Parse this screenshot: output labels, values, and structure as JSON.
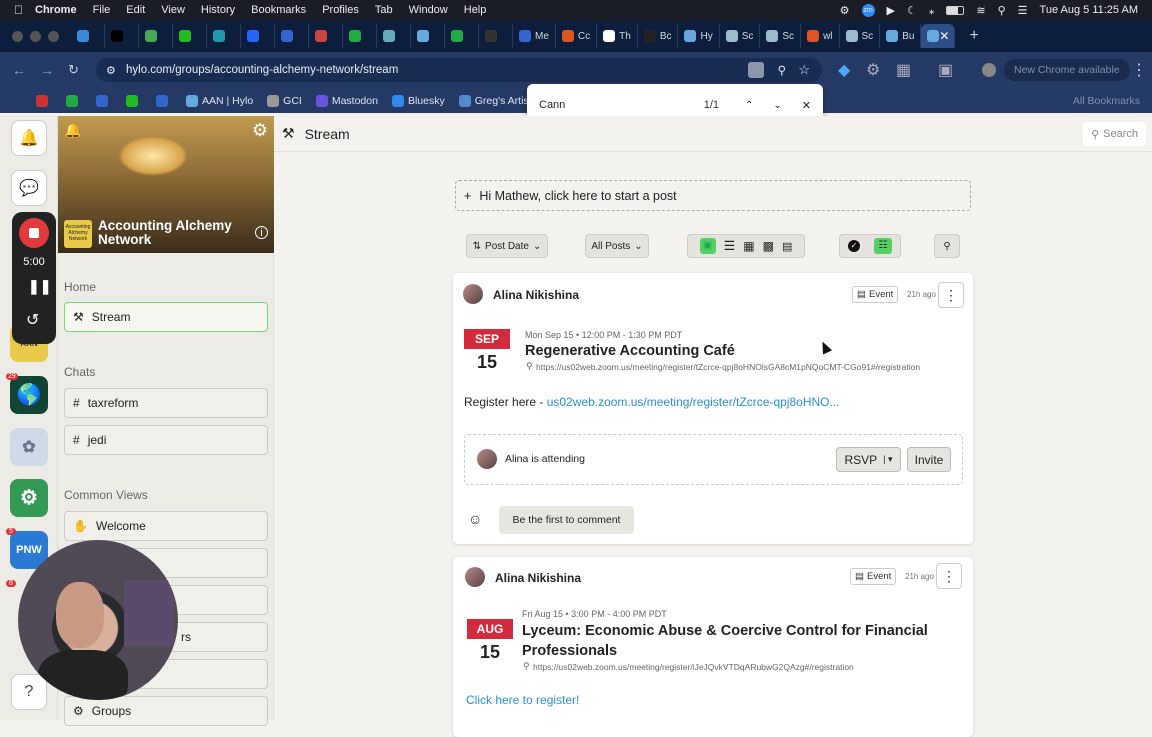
{
  "menubar": {
    "apple": "",
    "items": [
      "Chrome",
      "File",
      "Edit",
      "View",
      "History",
      "Bookmarks",
      "Profiles",
      "Tab",
      "Window",
      "Help"
    ],
    "clock": "Tue Aug 5  11:25 AM"
  },
  "tabs": [
    {
      "label": "",
      "c": "#3b8ad8"
    },
    {
      "label": "",
      "c": "#000"
    },
    {
      "label": "",
      "c": "#4a5"
    },
    {
      "label": "",
      "c": "#2b2"
    },
    {
      "label": "",
      "c": "#29a"
    },
    {
      "label": "",
      "c": "#2962ff"
    },
    {
      "label": "",
      "c": "#36c"
    },
    {
      "label": "",
      "c": "#c44"
    },
    {
      "label": "",
      "c": "#2a4"
    },
    {
      "label": "",
      "c": "#6ab"
    },
    {
      "label": "",
      "c": "#6ad"
    },
    {
      "label": "",
      "c": "#2a4"
    },
    {
      "label": "",
      "c": "#333"
    },
    {
      "label": "Me",
      "c": "#36c"
    },
    {
      "label": "Cc",
      "c": "#d52"
    },
    {
      "label": "Th",
      "c": "#fff"
    },
    {
      "label": "Bc",
      "c": "#222"
    },
    {
      "label": "Hy",
      "c": "#6ad"
    },
    {
      "label": "Sc",
      "c": "#9bc"
    },
    {
      "label": "Sc",
      "c": "#9bc"
    },
    {
      "label": "wl",
      "c": "#d52"
    },
    {
      "label": "Sc",
      "c": "#9bc"
    },
    {
      "label": "Bu",
      "c": "#6ad"
    },
    {
      "label": "",
      "c": "#6ad"
    }
  ],
  "address": {
    "url": "hylo.com/groups/accounting-alchemy-network/stream",
    "update": "New Chrome available"
  },
  "bookmarks": [
    {
      "label": "",
      "c": "#c33"
    },
    {
      "label": "",
      "c": "#2a4"
    },
    {
      "label": "",
      "c": "#36c"
    },
    {
      "label": "",
      "c": "#2b2"
    },
    {
      "label": "",
      "c": "#36c"
    },
    {
      "label": "AAN | Hylo",
      "c": "#6ad"
    },
    {
      "label": "GCI",
      "c": "#999"
    },
    {
      "label": "Mastodon",
      "c": "#65d"
    },
    {
      "label": "Bluesky",
      "c": "#38e"
    },
    {
      "label": "Greg's Artist",
      "c": "#58c"
    }
  ],
  "bookmarks_right": "All Bookmarks",
  "find": {
    "query": "Cann",
    "count": "1/1"
  },
  "recorder": {
    "time": "5:00"
  },
  "group": {
    "name": "Accounting Alchemy Network",
    "logo_text": "Accounting Alchemy Network"
  },
  "sidebar": {
    "home_label": "Home",
    "stream_label": "Stream",
    "chats_label": "Chats",
    "chat1": "taxreform",
    "chat2": "jedi",
    "common_label": "Common Views",
    "welcome": "Welcome",
    "rs": "rs",
    "groups": "Groups"
  },
  "topbar": {
    "title": "Stream",
    "search": "Search"
  },
  "startpost": "Hi Mathew, click here to start a post",
  "controls": {
    "sort": "Post Date",
    "filter": "All Posts"
  },
  "posts": [
    {
      "author": "Alina Nikishina",
      "type": "Event",
      "ago": "21h ago",
      "month": "SEP",
      "day": "15",
      "when": "Mon Sep 15 • 12:00 PM - 1:30 PM PDT",
      "title": "Regenerative Accounting Café",
      "location": "https://us02web.zoom.us/meeting/register/tZcrce-qpj8oHNOlsGA8cM1pNQoCMT-CGo91#/registration",
      "body_prefix": "Register here - ",
      "body_link": "us02web.zoom.us/meeting/register/tZcrce-qpj8oHNO...",
      "attending": "Alina is attending",
      "rsvp": "RSVP",
      "invite": "Invite",
      "comment": "Be the first to comment"
    },
    {
      "author": "Alina Nikishina",
      "type": "Event",
      "ago": "21h ago",
      "month": "AUG",
      "day": "15",
      "when": "Fri Aug 15 • 3:00 PM - 4:00 PM PDT",
      "title": "Lyceum: Economic Abuse & Coercive Control for Financial Professionals",
      "location": "https://us02web.zoom.us/meeting/register/iJeJQvkVTDqARubwG2QAzg#/registration",
      "body_link": "Click here to register!"
    }
  ],
  "rail": {
    "badge1": "29",
    "badge2": "5",
    "badge3": "8"
  }
}
